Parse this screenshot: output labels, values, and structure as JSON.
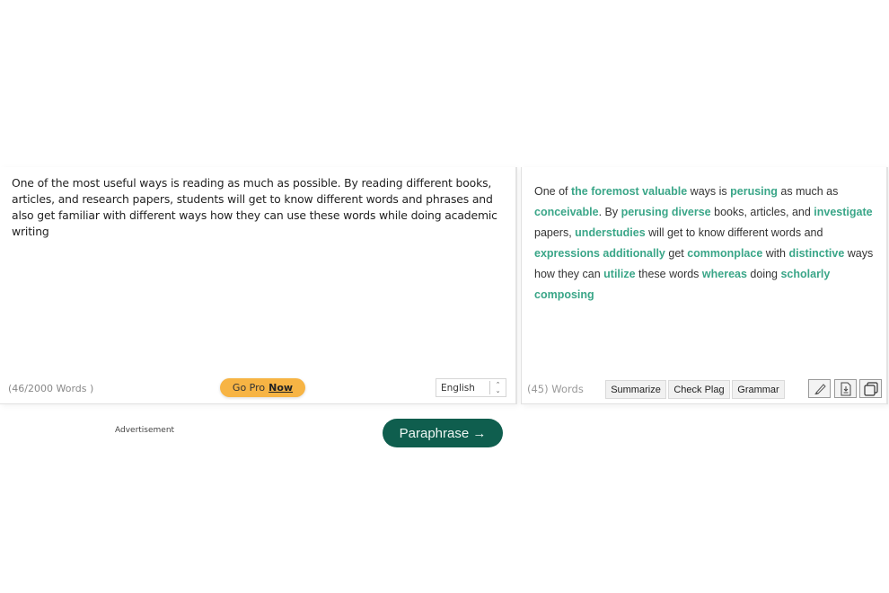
{
  "input": {
    "text": "One of the most useful ways is reading as much as possible. By reading different books, articles, and research papers, students will get to know different words and phrases and also get familiar with different ways how they can use these words while doing academic writing",
    "word_count": "(46/2000 Words )",
    "go_pro_prefix": "Go Pro",
    "go_pro_link": "Now",
    "language": {
      "selected": "English",
      "up_glyph": "⌃",
      "down_glyph": "⌄"
    }
  },
  "output": {
    "segments": [
      {
        "text": "One of ",
        "changed": false
      },
      {
        "text": "the foremost valuable",
        "changed": true
      },
      {
        "text": " ways is ",
        "changed": false
      },
      {
        "text": "perusing",
        "changed": true
      },
      {
        "text": " as much as ",
        "changed": false
      },
      {
        "text": "conceivable",
        "changed": true
      },
      {
        "text": ". By ",
        "changed": false
      },
      {
        "text": "perusing diverse",
        "changed": true
      },
      {
        "text": " books, articles, and ",
        "changed": false
      },
      {
        "text": "investigate",
        "changed": true
      },
      {
        "text": " papers, ",
        "changed": false
      },
      {
        "text": "understudies",
        "changed": true
      },
      {
        "text": " will get to know different words and ",
        "changed": false
      },
      {
        "text": "expressions additionally",
        "changed": true
      },
      {
        "text": " get ",
        "changed": false
      },
      {
        "text": "commonplace",
        "changed": true
      },
      {
        "text": " with ",
        "changed": false
      },
      {
        "text": "distinctive",
        "changed": true
      },
      {
        "text": " ways how they can ",
        "changed": false
      },
      {
        "text": "utilize",
        "changed": true
      },
      {
        "text": " these words ",
        "changed": false
      },
      {
        "text": "whereas",
        "changed": true
      },
      {
        "text": " doing ",
        "changed": false
      },
      {
        "text": "scholarly composing",
        "changed": true
      }
    ],
    "word_count": "(45) Words",
    "buttons": {
      "summarize": "Summarize",
      "check_plag": "Check Plag",
      "grammar": "Grammar"
    },
    "icons": [
      "highlighter-icon",
      "download-icon",
      "copy-icon"
    ]
  },
  "footer": {
    "advertisement": "Advertisement",
    "paraphrase_label": "Paraphrase →"
  },
  "colors": {
    "changed_word": "#3aa688",
    "primary_button": "#0f5e4e",
    "go_pro": "#f7b444"
  }
}
